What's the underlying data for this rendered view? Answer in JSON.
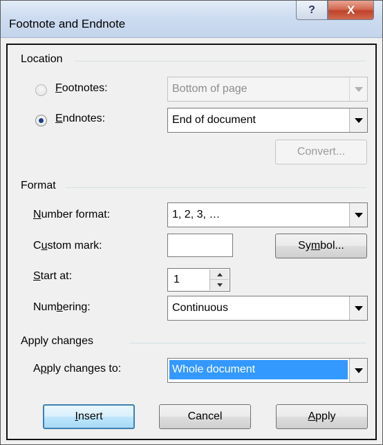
{
  "window": {
    "title": "Footnote and Endnote",
    "help_glyph": "?",
    "close_glyph": "X"
  },
  "location": {
    "section_label": "Location",
    "footnotes": {
      "mnemonic": "F",
      "rest": "ootnotes:",
      "value": "Bottom of page",
      "checked": false,
      "enabled": false
    },
    "endnotes": {
      "mnemonic": "E",
      "rest": "ndnotes:",
      "value": "End of document",
      "checked": true,
      "enabled": true
    },
    "convert_label": "Convert..."
  },
  "format": {
    "section_label": "Format",
    "number_format": {
      "mnemonic": "N",
      "rest": "umber format:",
      "value": "1, 2, 3, …"
    },
    "custom_mark": {
      "pre": "C",
      "mnemonic": "u",
      "rest": "stom mark:",
      "value": ""
    },
    "symbol_button": {
      "pre": "Sy",
      "mnemonic": "m",
      "rest": "bol..."
    },
    "start_at": {
      "mnemonic": "S",
      "rest": "tart at:",
      "value": "1"
    },
    "numbering": {
      "pre": "Num",
      "mnemonic": "b",
      "rest": "ering:",
      "value": "Continuous"
    }
  },
  "apply_changes": {
    "section_label": "Apply changes",
    "apply_to": {
      "pre": "A",
      "mnemonic": "p",
      "rest": "ply changes to:",
      "value": "Whole document"
    }
  },
  "buttons": {
    "insert": {
      "mnemonic": "I",
      "rest": "nsert"
    },
    "cancel": "Cancel",
    "apply": {
      "mnemonic": "A",
      "rest": "pply"
    }
  },
  "colors": {
    "selection": "#3399ff",
    "close_button": "#c0432b",
    "dialog_bg": "#f0f0f0"
  }
}
